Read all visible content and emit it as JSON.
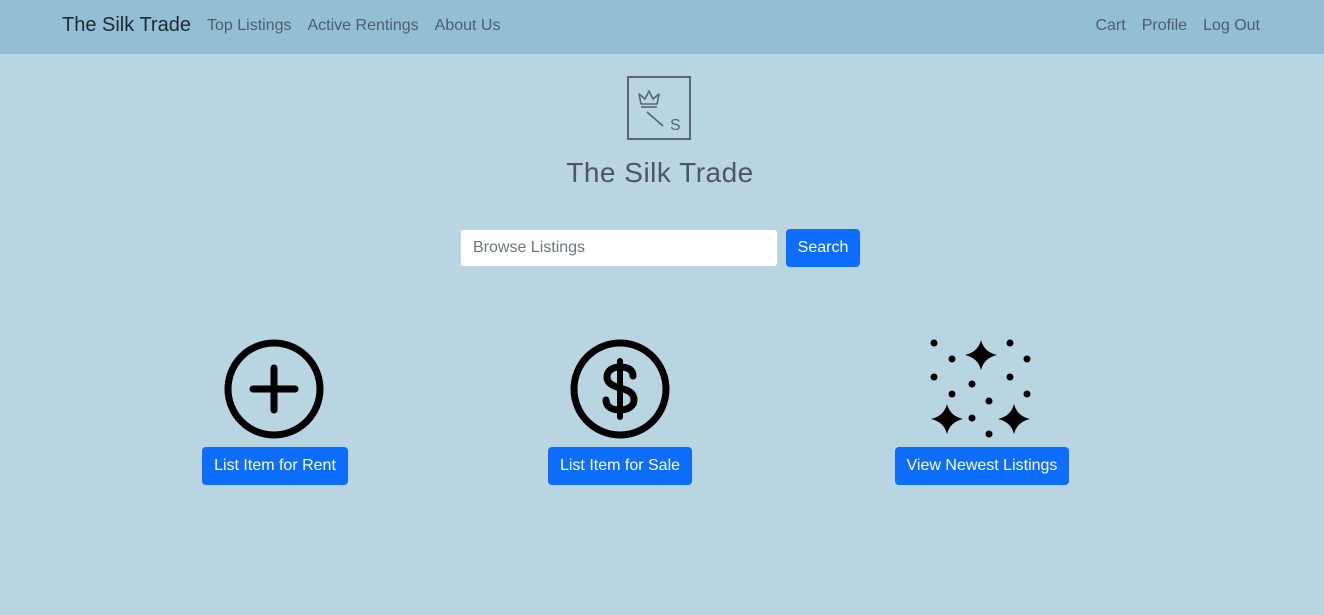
{
  "nav": {
    "brand": "The Silk Trade",
    "left_links": [
      "Top Listings",
      "Active Rentings",
      "About Us"
    ],
    "right_links": [
      "Cart",
      "Profile",
      "Log Out"
    ]
  },
  "hero": {
    "logo_icon": "crown-slash-s-logo",
    "logo_letter": "S",
    "title": "The Silk Trade"
  },
  "search": {
    "placeholder": "Browse Listings",
    "value": "",
    "button_label": "Search"
  },
  "features": [
    {
      "icon": "plus-circle-icon",
      "button_label": "List Item for Rent"
    },
    {
      "icon": "dollar-circle-icon",
      "button_label": "List Item for Sale"
    },
    {
      "icon": "sparkles-icon",
      "button_label": "View Newest Listings"
    }
  ],
  "colors": {
    "navbar_bg": "#92bfd3",
    "page_bg": "#b8d5e1",
    "primary_button": "#0d6efd",
    "title_text": "#4e5569"
  }
}
